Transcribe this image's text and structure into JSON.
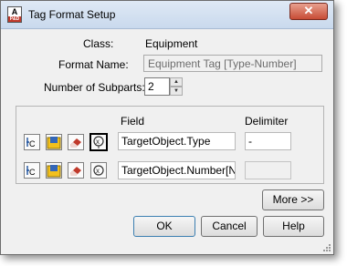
{
  "window": {
    "title": "Tag Format Setup",
    "close_glyph": "✕",
    "app_icon_text": "A",
    "app_icon_sub": "P&D"
  },
  "form": {
    "class_label": "Class:",
    "class_value": "Equipment",
    "format_name_label": "Format Name:",
    "format_name_value": "Equipment Tag [Type-Number]",
    "subparts_label": "Number of Subparts:",
    "subparts_value": "2"
  },
  "subparts": {
    "field_header": "Field",
    "delimiter_header": "Delimiter",
    "rows": [
      {
        "field": "TargetObject.Type",
        "delimiter": "-"
      },
      {
        "field": "TargetObject.Number[NNN]",
        "delimiter": ""
      }
    ]
  },
  "buttons": {
    "more": "More >>",
    "ok": "OK",
    "cancel": "Cancel",
    "help": "Help"
  },
  "icons": [
    "object-property-icon",
    "folder-list-icon",
    "eraser-icon",
    "expression-icon"
  ]
}
